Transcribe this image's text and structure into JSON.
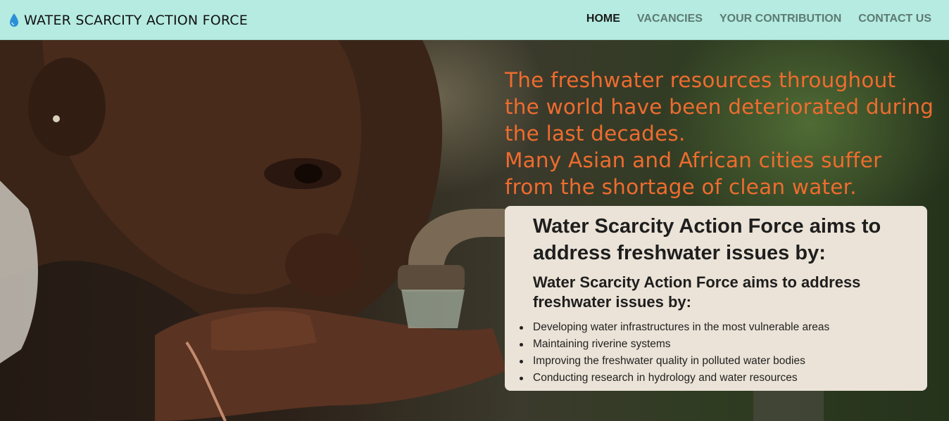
{
  "navbar": {
    "brand_icon": "water-drop-icon",
    "brand": "WATER SCARCITY ACTION FORCE",
    "links": [
      {
        "label": "HOME",
        "active": true
      },
      {
        "label": "VACANCIES",
        "active": false
      },
      {
        "label": "YOUR CONTRIBUTION",
        "active": false
      },
      {
        "label": "CONTACT US",
        "active": false
      }
    ]
  },
  "hero": {
    "headline": [
      "The freshwater resources throughout",
      "the world have been deteriorated during",
      "the last decades.",
      "Many Asian and African cities suffer",
      "from the shortage of clean water."
    ],
    "card": {
      "title": "Water Scarcity Action Force aims to address freshwater issues by:",
      "subtitle": "Water Scarcity Action Force aims to address freshwater issues by:",
      "items": [
        "Developing water infrastructures in the most vulnerable areas",
        "Maintaining riverine systems",
        "Improving the freshwater quality in polluted water bodies",
        "Conducting research in hydrology and water resources"
      ]
    }
  },
  "colors": {
    "navbar_bg": "#b5ebe1",
    "headline": "#ee6c2f",
    "card_bg": "#ebe3d7",
    "drop": "#2b8fd6"
  }
}
